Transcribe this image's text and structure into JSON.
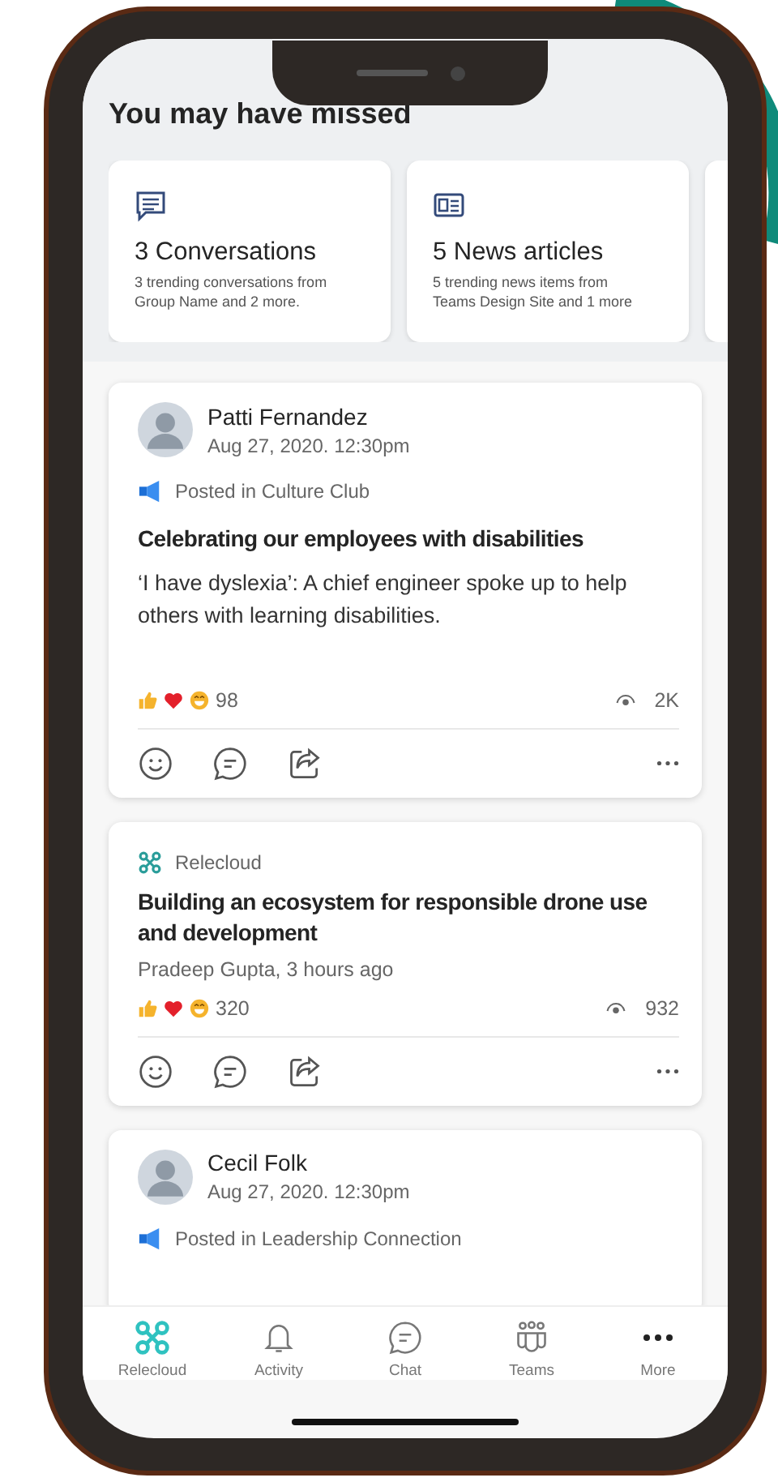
{
  "missed": {
    "title": "You may have missed",
    "cards": [
      {
        "kind": "conversations",
        "title": "3 Conversations",
        "text": "3 trending conversations from Group Name and 2 more."
      },
      {
        "kind": "news",
        "title": "5 News articles",
        "text": "5 trending news items from Teams Design Site and 1 more"
      },
      {
        "kind": "other"
      }
    ]
  },
  "posts": [
    {
      "kind": "person",
      "author": "Patti Fernandez",
      "time": "Aug 27, 2020. 12:30pm",
      "channel": "Posted in Culture Club",
      "title": "Celebrating our employees with disabilities",
      "body": "‘I have dyslexia’: A chief engineer spoke up to help others with learning disabilities.",
      "reactions": "98",
      "views": "2K"
    },
    {
      "kind": "news",
      "source": "Relecloud",
      "title": "Building an ecosystem for responsible drone use and development",
      "byline": "Pradeep Gupta, 3 hours ago",
      "reactions": "320",
      "views": "932"
    },
    {
      "kind": "person",
      "author": "Cecil Folk",
      "time": "Aug 27, 2020. 12:30pm",
      "channel": "Posted in Leadership Connection"
    }
  ],
  "nav": [
    {
      "kind": "drone",
      "label": "Relecloud",
      "selected": true
    },
    {
      "kind": "bell",
      "label": "Activity",
      "selected": false
    },
    {
      "kind": "chat",
      "label": "Chat",
      "selected": false
    },
    {
      "kind": "teams",
      "label": "Teams",
      "selected": false
    },
    {
      "kind": "more",
      "label": "More",
      "selected": false
    }
  ]
}
